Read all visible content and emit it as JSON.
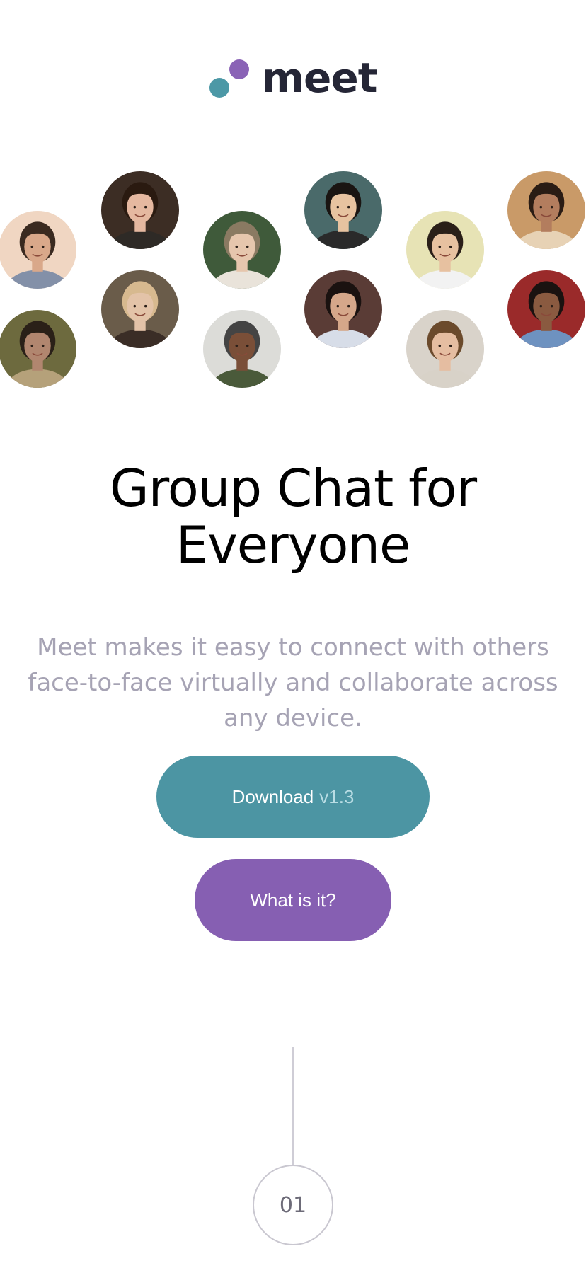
{
  "brand": {
    "name": "meet",
    "colors": {
      "purple": "#8a63b6",
      "teal": "#4c98a6",
      "text": "#252636"
    }
  },
  "avatars": [
    {
      "name": "avatar-1",
      "bg": "#f0d6c2",
      "skin": "#d9a88a",
      "hair": "#3a2a20",
      "shirt": "#8390a8"
    },
    {
      "name": "avatar-2",
      "bg": "#6d6a3e",
      "skin": "#b1866f",
      "hair": "#2a2018",
      "shirt": "#b5a17a"
    },
    {
      "name": "avatar-3",
      "bg": "#3c2d24",
      "skin": "#e5b8a0",
      "hair": "#2a1a10",
      "shirt": "#2e2a26"
    },
    {
      "name": "avatar-4",
      "bg": "#6a5c4a",
      "skin": "#e3c3a8",
      "hair": "#d7b98f",
      "shirt": "#3a2d26"
    },
    {
      "name": "avatar-5",
      "bg": "#3f5a3a",
      "skin": "#e6c6ad",
      "hair": "#8a7a62",
      "shirt": "#e9e3da"
    },
    {
      "name": "avatar-6",
      "bg": "#dcdcd8",
      "skin": "#7a4f38",
      "hair": "#444444",
      "shirt": "#4a5a3a"
    },
    {
      "name": "avatar-7",
      "bg": "#4a6a6a",
      "skin": "#e7c3a0",
      "hair": "#1a1512",
      "shirt": "#2a2a2a"
    },
    {
      "name": "avatar-8",
      "bg": "#5a3c36",
      "skin": "#d5a78a",
      "hair": "#1a1210",
      "shirt": "#d7dde8"
    },
    {
      "name": "avatar-9",
      "bg": "#e7e3b5",
      "skin": "#e7c1a0",
      "hair": "#2a1f18",
      "shirt": "#f2f2f2"
    },
    {
      "name": "avatar-10",
      "bg": "#d9d3ca",
      "skin": "#e5bda1",
      "hair": "#6b4a2c",
      "shirt": "#d8d2c8"
    },
    {
      "name": "avatar-11",
      "bg": "#c99a68",
      "skin": "#b37d5e",
      "hair": "#2a1c14",
      "shirt": "#e7d2b5"
    },
    {
      "name": "avatar-12",
      "bg": "#9a2a2a",
      "skin": "#8a5a40",
      "hair": "#1a1210",
      "shirt": "#6e92c0"
    }
  ],
  "hero": {
    "title_line1": "Group Chat for",
    "title_line2": "Everyone",
    "description": "Meet makes it easy to connect with others face-to-face virtually and collaborate across any device."
  },
  "buttons": {
    "download_label": "Download",
    "download_version": "v1.3",
    "what_label": "What is it?"
  },
  "step": {
    "number": "01"
  }
}
